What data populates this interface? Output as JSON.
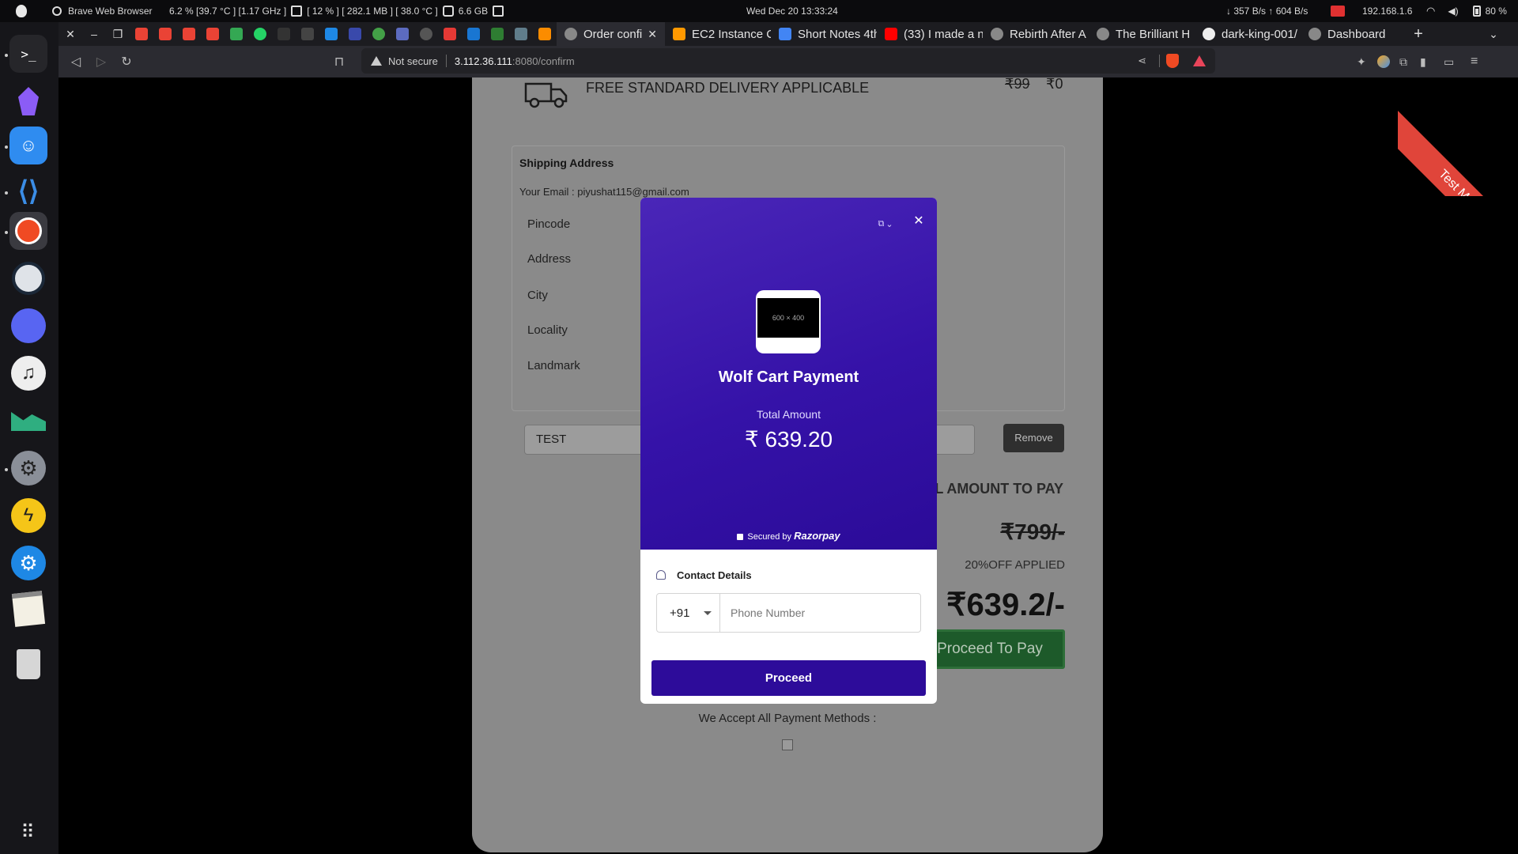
{
  "system": {
    "app_name": "Brave Web Browser",
    "cpu": "6.2 % [39.7 °C ] [1.17 GHz ]",
    "gpu": "[ 12  % ] [ 282.1 MB ] [ 38.0 °C ]",
    "memory": "6.6 GB",
    "datetime": "Wed Dec 20  13:33:24",
    "network": "↓ 357 B/s ↑ 604 B/s",
    "ip": "192.168.1.6",
    "battery": "80 %"
  },
  "tabs": [
    {
      "label": "Order confi",
      "active": true
    },
    {
      "label": "EC2 Instance C"
    },
    {
      "label": "Short Notes 4th"
    },
    {
      "label": "(33) I made a n"
    },
    {
      "label": "Rebirth After A"
    },
    {
      "label": "The Brilliant H"
    },
    {
      "label": "dark-king-001/"
    },
    {
      "label": "Dashboard"
    }
  ],
  "address_bar": {
    "security": "Not secure",
    "host": "3.112.36.111",
    "path": ":8080/confirm"
  },
  "page": {
    "delivery_text": "FREE STANDARD DELIVERY APPLICABLE",
    "delivery_old": "₹99",
    "delivery_new": "₹0",
    "shipping_title": "Shipping Address",
    "email": "Your Email : piyushat115@gmail.com",
    "fields": [
      "Pincode",
      "Address",
      "City",
      "Locality",
      "Landmark"
    ],
    "coupon_value": "TEST",
    "remove_label": "Remove",
    "amount_label": "L AMOUNT TO PAY",
    "amount_old": "₹799/-",
    "discount": "20%OFF APPLIED",
    "amount_final": "₹639.2/-",
    "proceed_to_pay": "Proceed To Pay",
    "accept_label": "We Accept All Payment Methods :",
    "ribbon": "Test Mode"
  },
  "modal": {
    "logo_placeholder": "600 × 400",
    "merchant": "Wolf Cart Payment",
    "total_label": "Total Amount",
    "total_amount": "₹ 639.20",
    "secured_by": "Secured by",
    "brand": "Razorpay",
    "contact_label": "Contact Details",
    "country_code": "+91",
    "phone_placeholder": "Phone Number",
    "proceed_label": "Proceed"
  }
}
